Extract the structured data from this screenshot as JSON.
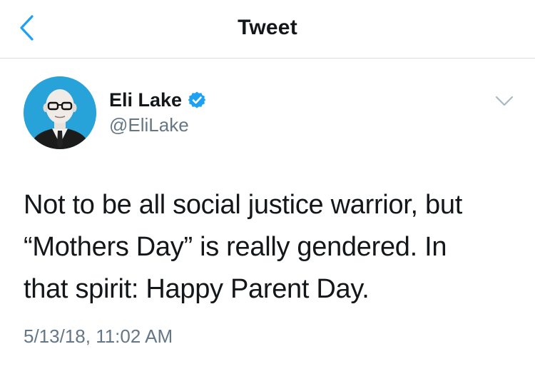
{
  "nav": {
    "title": "Tweet",
    "back_icon": "chevron-left-icon"
  },
  "tweet": {
    "author_name": "Eli Lake",
    "verified": true,
    "handle": "@EliLake",
    "text": "Not to be all social justice warrior, but\n“Mothers Day” is really gendered. In\nthat spirit: Happy Parent Day.",
    "timestamp": "5/13/18, 11:02 AM",
    "menu_icon": "chevron-down-icon"
  },
  "colors": {
    "accent": "#1da1f2",
    "text": "#14171a",
    "muted": "#657786",
    "divider": "#d8dde1",
    "avatar_bg": "#27a3d9"
  }
}
